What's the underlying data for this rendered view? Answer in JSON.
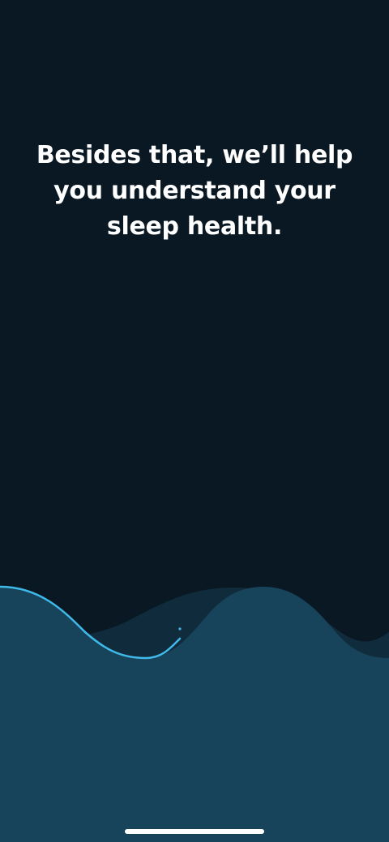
{
  "onboarding": {
    "headline": "Besides that, we’ll help you understand your sleep health."
  },
  "colors": {
    "background": "#0a1824",
    "wave_fill": "#17445a",
    "wave_back": "#102b3b",
    "wave_line": "#3fb9ea",
    "text": "#ffffff"
  },
  "decor": {
    "sleep_wave": "sleep-wave-graphic",
    "home_indicator": "home-indicator-bar"
  }
}
